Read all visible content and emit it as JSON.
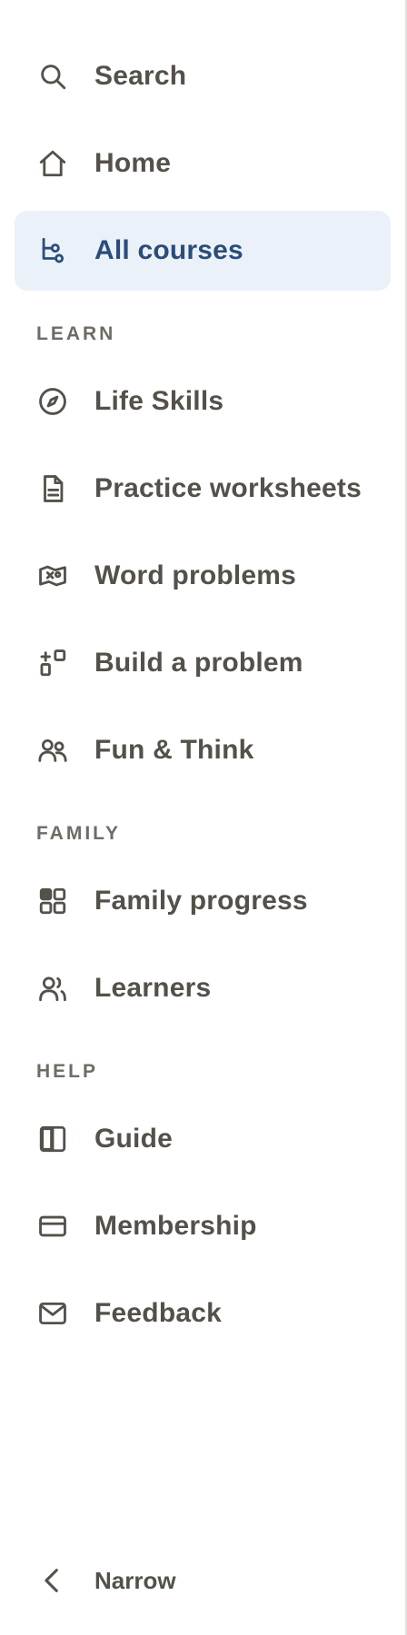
{
  "nav": {
    "search": "Search",
    "home": "Home",
    "all_courses": "All courses"
  },
  "sections": {
    "learn": "LEARN",
    "family": "FAMILY",
    "help": "HELP"
  },
  "learn_items": {
    "life_skills": "Life Skills",
    "practice_worksheets": "Practice worksheets",
    "word_problems": "Word problems",
    "build_a_problem": "Build a problem",
    "fun_and_think": "Fun & Think"
  },
  "family_items": {
    "family_progress": "Family progress",
    "learners": "Learners"
  },
  "help_items": {
    "guide": "Guide",
    "membership": "Membership",
    "feedback": "Feedback"
  },
  "footer": {
    "narrow": "Narrow"
  },
  "colors": {
    "text": "#54504a",
    "active_text": "#2b4d7a",
    "active_bg": "#ebf1f8",
    "section_text": "#6f6b65"
  },
  "active_item": "All courses"
}
